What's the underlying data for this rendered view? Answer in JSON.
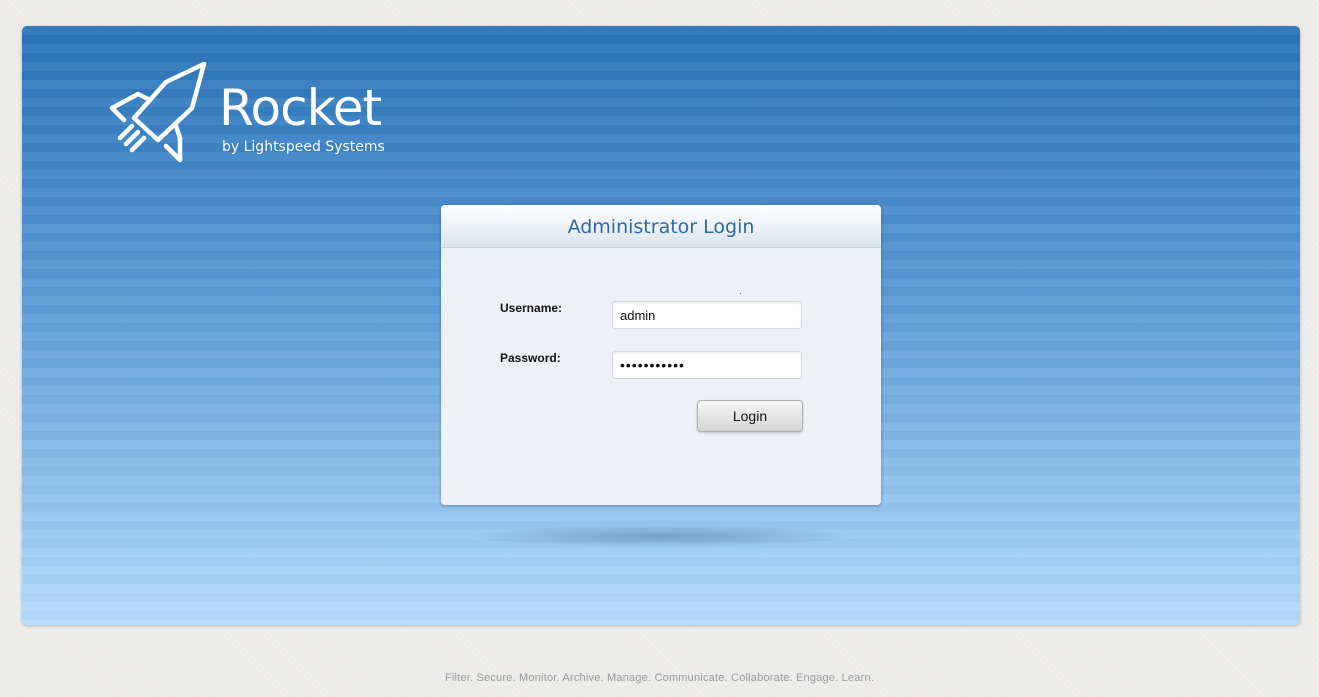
{
  "brand": {
    "name": "Rocket",
    "byline": "by Lightspeed Systems",
    "icon": "rocket-icon"
  },
  "login": {
    "title": "Administrator Login",
    "username_label": "Username:",
    "username_value": "admin",
    "password_label": "Password:",
    "password_value": "•••••••••••",
    "submit_label": "Login",
    "marker": "."
  },
  "footer": {
    "tagline": "Filter. Secure. Monitor. Archive. Manage. Communicate. Collaborate. Engage. Learn."
  },
  "colors": {
    "accent": "#2d6aa5",
    "background_top": "#2a73b8",
    "background_bottom": "#b4dcfc"
  }
}
